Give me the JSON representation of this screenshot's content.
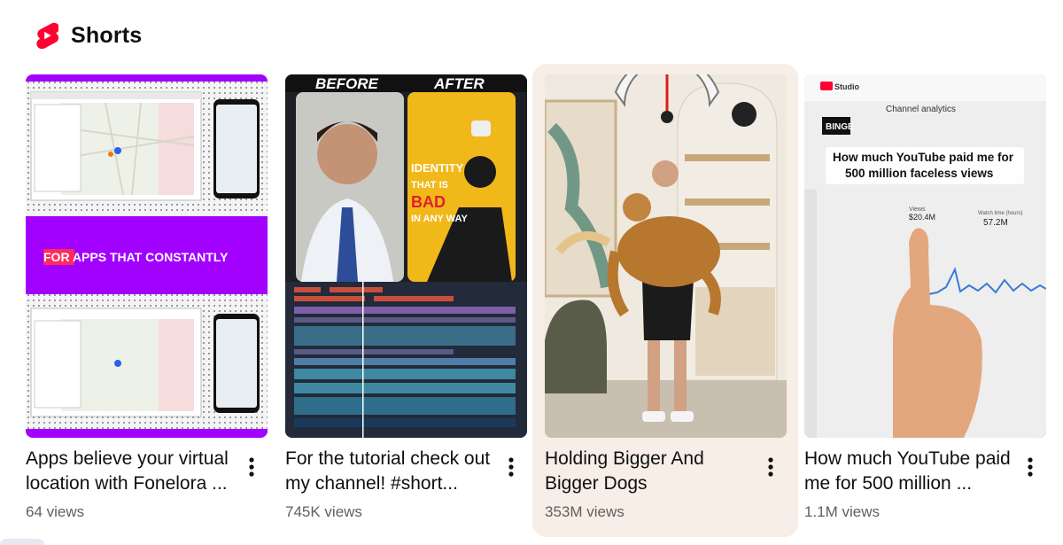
{
  "shelf": {
    "title": "Shorts",
    "icon": "youtube-shorts-logo",
    "accent": "#ff0033"
  },
  "cards": [
    {
      "title": "Apps believe your virtual location with Fonelora ...",
      "views": "64 views",
      "thumb_banner": "FOR APPS THAT CONSTANTLY",
      "thumb_banner_highlight": "FOR",
      "thumb_color": "#a200ff"
    },
    {
      "title": "For the tutorial check out my channel! #short...",
      "views": "745K views",
      "thumb_before": "BEFORE",
      "thumb_after": "AFTER",
      "thumb_lines": [
        "IDENTITY",
        "THAT IS",
        "BAD",
        "IN ANY WAY"
      ]
    },
    {
      "title": "Holding Bigger And Bigger Dogs",
      "views": "353M views",
      "hovered": true
    },
    {
      "title": "How much YouTube paid me for 500 million ...",
      "views": "1.1M views",
      "thumb_caption": "How much YouTube paid me for 500 million faceless views",
      "thumb_studio": "Studio",
      "thumb_heading": "Channel analytics",
      "thumb_channel": "BINGE",
      "thumb_views_label": "Views",
      "thumb_views_value": "$20.4M",
      "thumb_watch_label": "Watch time (hours)",
      "thumb_watch_value": "57.2M"
    }
  ]
}
